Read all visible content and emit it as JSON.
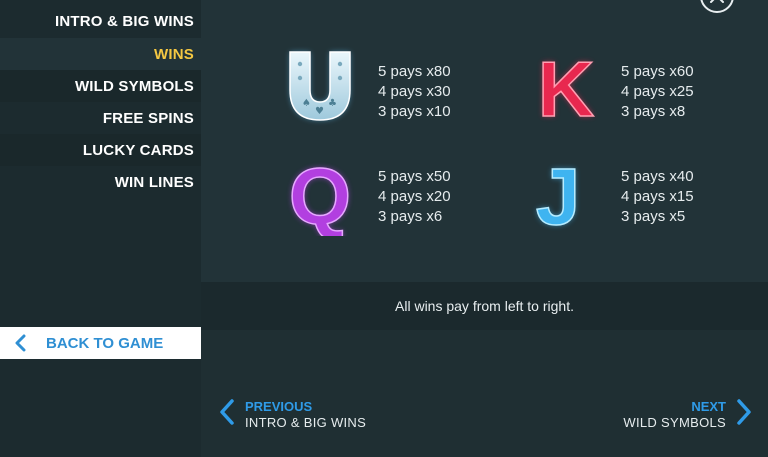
{
  "sidebar": {
    "items": [
      {
        "label": "INTRO & BIG WINS"
      },
      {
        "label": "WINS"
      },
      {
        "label": "WILD SYMBOLS"
      },
      {
        "label": "FREE SPINS"
      },
      {
        "label": "LUCKY CARDS"
      },
      {
        "label": "WIN LINES"
      }
    ],
    "active_index": 1,
    "back_label": "BACK TO GAME"
  },
  "symbols": [
    {
      "icon": "horseshoe-icon",
      "pays": [
        "5 pays x80",
        "4 pays x30",
        "3 pays x10"
      ]
    },
    {
      "icon": "letter-k-icon",
      "letter": "K",
      "pays": [
        "5 pays x60",
        "4 pays x25",
        "3 pays x8"
      ]
    },
    {
      "icon": "letter-q-icon",
      "letter": "Q",
      "pays": [
        "5 pays x50",
        "4 pays x20",
        "3 pays x6"
      ]
    },
    {
      "icon": "letter-j-icon",
      "letter": "J",
      "pays": [
        "5 pays x40",
        "4 pays x15",
        "3 pays x5"
      ]
    }
  ],
  "notice": "All wins pay from left to right.",
  "footer": {
    "previous_title": "PREVIOUS",
    "previous_sub": "INTRO & BIG WINS",
    "next_title": "NEXT",
    "next_sub": "WILD SYMBOLS"
  },
  "colors": {
    "active_nav": "#f5c842",
    "accent_blue": "#2f9be8",
    "k_red": "#e8284f",
    "q_purple": "#b23fe0",
    "j_blue": "#3fb4f0"
  }
}
